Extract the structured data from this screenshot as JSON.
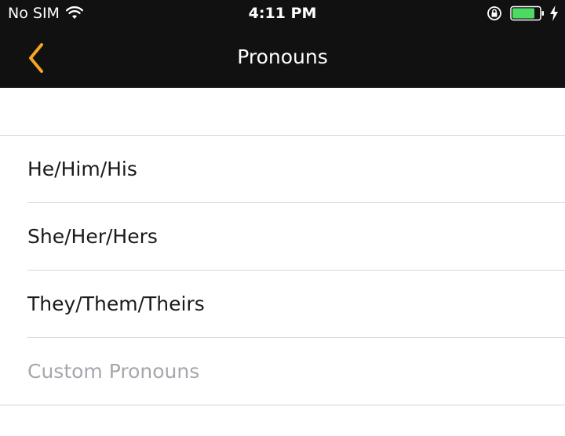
{
  "status_bar": {
    "carrier": "No SIM",
    "time": "4:11 PM",
    "battery_color": "#4cd964"
  },
  "nav": {
    "title": "Pronouns",
    "accent_color": "#f5a623",
    "back_icon": "chevron-left-icon"
  },
  "pronoun_options": [
    {
      "label": "He/Him/His"
    },
    {
      "label": "She/Her/Hers"
    },
    {
      "label": "They/Them/Theirs"
    }
  ],
  "custom": {
    "placeholder": "Custom Pronouns"
  }
}
